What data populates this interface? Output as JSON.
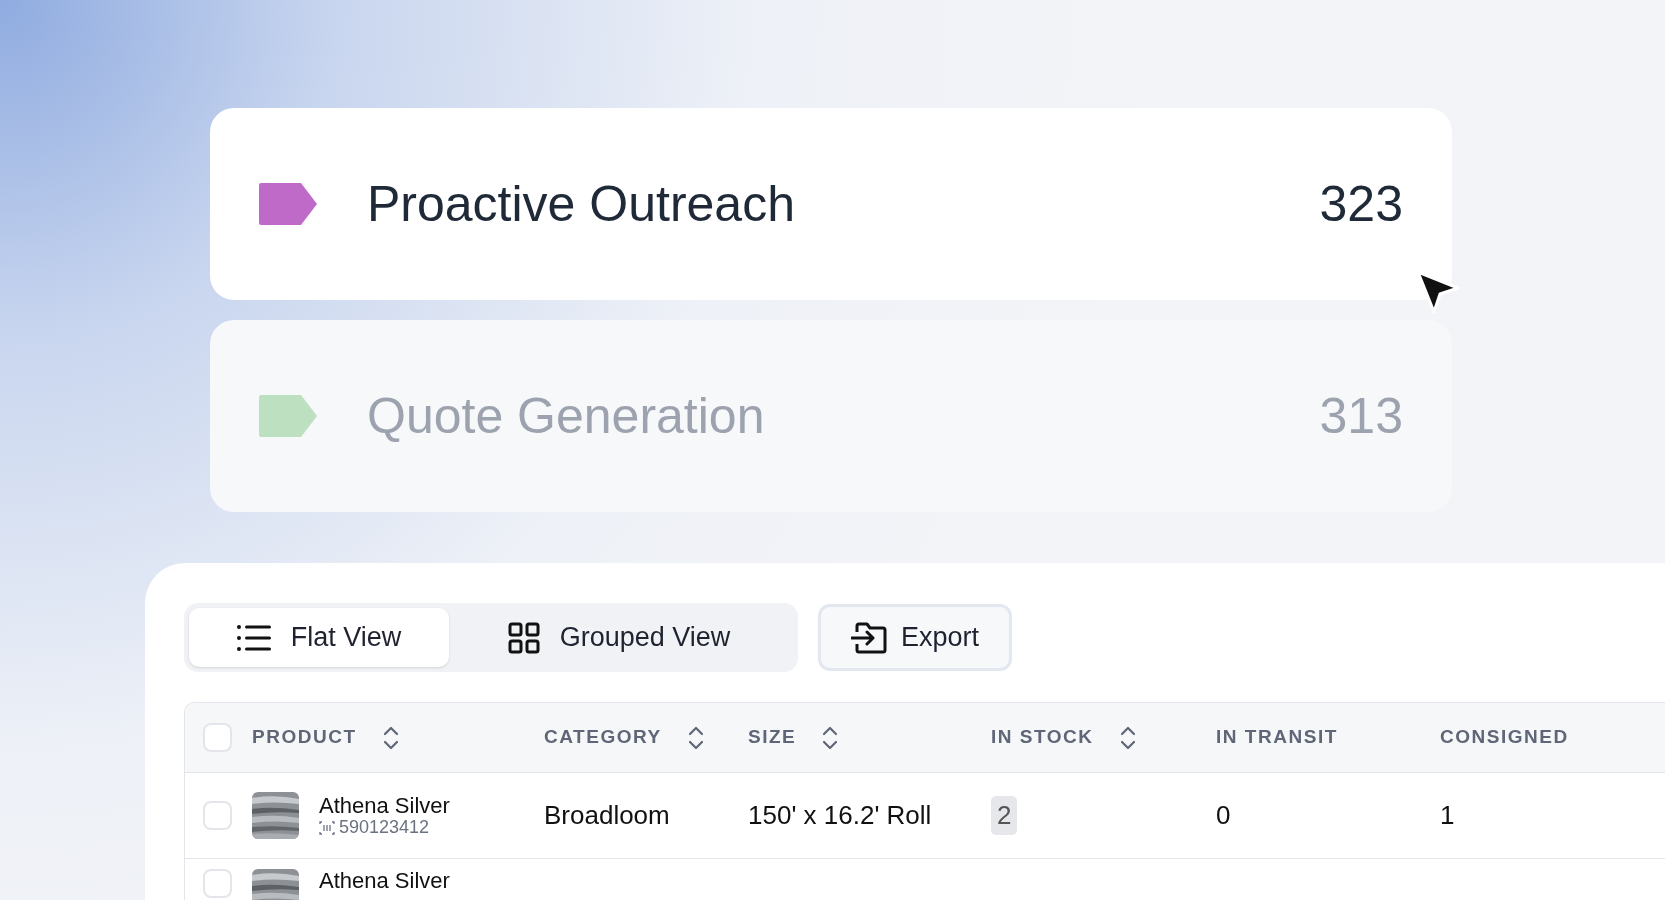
{
  "segments": [
    {
      "label": "Proactive Outreach",
      "count": "323",
      "color": "#bf6ac8",
      "selected": true
    },
    {
      "label": "Quote Generation",
      "count": "313",
      "color": "#bce0c0",
      "selected": false
    }
  ],
  "view_tabs": [
    {
      "label": "Flat View",
      "kind": "list",
      "selected": true
    },
    {
      "label": "Grouped View",
      "kind": "grid",
      "selected": false
    }
  ],
  "export_button": {
    "label": "Export"
  },
  "table": {
    "select_all_checked": false,
    "columns": [
      {
        "label": "PRODUCT",
        "sortable": true
      },
      {
        "label": "CATEGORY",
        "sortable": true
      },
      {
        "label": "SIZE",
        "sortable": true
      },
      {
        "label": "IN STOCK",
        "sortable": true
      },
      {
        "label": "IN TRANSIT",
        "sortable": false
      },
      {
        "label": "CONSIGNED",
        "sortable": false
      }
    ],
    "rows": [
      {
        "checked": false,
        "product": "Athena Silver",
        "sku": "590123412",
        "category": "Broadloom",
        "size": "150' x 16.2' Roll",
        "in_stock": {
          "text": "2",
          "color": "#e5e7eb"
        },
        "in_transit": "0",
        "consigned": "1"
      },
      {
        "checked": false,
        "product": "Athena Silver"
      }
    ]
  }
}
